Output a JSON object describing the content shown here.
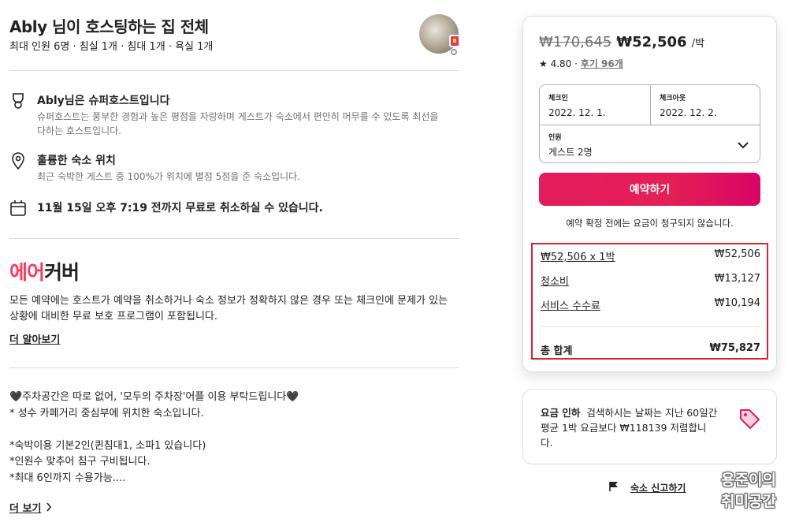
{
  "listing": {
    "title": "Ably 님이 호스팅하는 집 전체",
    "subtitle": "최대 인원 6명 · 침실 1개 · 침대 1개 · 욕실 1개"
  },
  "features": [
    {
      "icon": "trophy-icon",
      "title": "Ably님은 슈퍼호스트입니다",
      "desc": "슈퍼호스트는 풍부한 경험과 높은 평점을 자랑하며 게스트가 숙소에서 편안히 머무를 수 있도록 최선을 다하는 호스트입니다."
    },
    {
      "icon": "location-pin-icon",
      "title": "훌륭한 숙소 위치",
      "desc": "최근 숙박한 게스트 중 100%가 위치에 별점 5점을 준 숙소입니다."
    },
    {
      "icon": "calendar-icon",
      "title": "11월 15일 오후 7:19 전까지 무료로 취소하실 수 있습니다.",
      "desc": ""
    }
  ],
  "aircover": {
    "logo_red": "에어",
    "logo_black": "커버",
    "desc": "모든 예약에는 호스트가 예약을 취소하거나 숙소 정보가 정확하지 않은 경우 또는 체크인에 문제가 있는 상황에 대비한 무료 보호 프로그램이 포함됩니다.",
    "learn_more": "더 알아보기"
  },
  "description": {
    "lines": [
      "🖤주차공간은 따로 없어, '모두의 주차장'어플 이용 부탁드립니다🖤",
      "* 성수 카페거리 중심부에 위치한 숙소입니다.",
      "",
      "*숙박이용 기본2인(퀸침대1, 소파1 있습니다)",
      "*인원수 맞추어 침구 구비됩니다.",
      "*최대 6인까지 수용가능...."
    ],
    "show_more": "더 보기"
  },
  "booking": {
    "old_price": "₩170,645",
    "new_price": "₩52,506",
    "per_night": "/박",
    "rating": "★ 4.80 ·",
    "reviews": "후기 96개",
    "checkin_label": "체크인",
    "checkin_value": "2022. 12. 1.",
    "checkout_label": "체크아웃",
    "checkout_value": "2022. 12. 2.",
    "guests_label": "인원",
    "guests_value": "게스트 2명",
    "reserve_button": "예약하기",
    "note": "예약 확정 전에는 요금이 청구되지 않습니다.",
    "items": [
      {
        "label": "₩52,506 x 1박",
        "amount": "₩52,506"
      },
      {
        "label": "청소비",
        "amount": "₩13,127"
      },
      {
        "label": "서비스 수수료",
        "amount": "₩10,194"
      }
    ],
    "total_label": "총 합계",
    "total_amount": "₩75,827"
  },
  "price_drop": {
    "bold": "요금 인하",
    "text": "검색하시는 날짜는 지난 60일간 평균 1박 요금보다 ₩118139 저렴합니다."
  },
  "report": {
    "label": "숙소 신고하기"
  },
  "watermark": {
    "line1": "용준이의",
    "line2": "취미공간"
  },
  "colors": {
    "brand": "#ff385c",
    "reserve": "#e31c5f",
    "highlight_box": "#d9232e"
  }
}
